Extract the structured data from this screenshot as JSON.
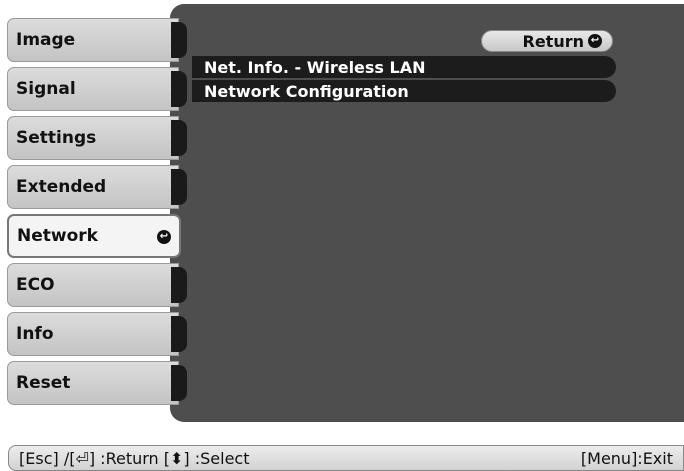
{
  "menu": {
    "items": [
      {
        "label": "Image"
      },
      {
        "label": "Signal"
      },
      {
        "label": "Settings"
      },
      {
        "label": "Extended"
      },
      {
        "label": "Network",
        "selected": true
      },
      {
        "label": "ECO"
      },
      {
        "label": "Info"
      },
      {
        "label": "Reset"
      }
    ]
  },
  "submenu": {
    "return_label": "Return",
    "items": [
      {
        "label": "Net. Info. - Wireless LAN"
      },
      {
        "label": "Network Configuration"
      }
    ]
  },
  "help_bar": {
    "left_text": "[Esc] /[⏎] :Return  [⬍] :Select",
    "right_text": "[Menu]:Exit"
  },
  "colors": {
    "panel": "#4e4e4e",
    "menu_item": "#cfcfcf",
    "selected_item": "#f4f4f4",
    "submenu_row": "#1c1c1c"
  }
}
